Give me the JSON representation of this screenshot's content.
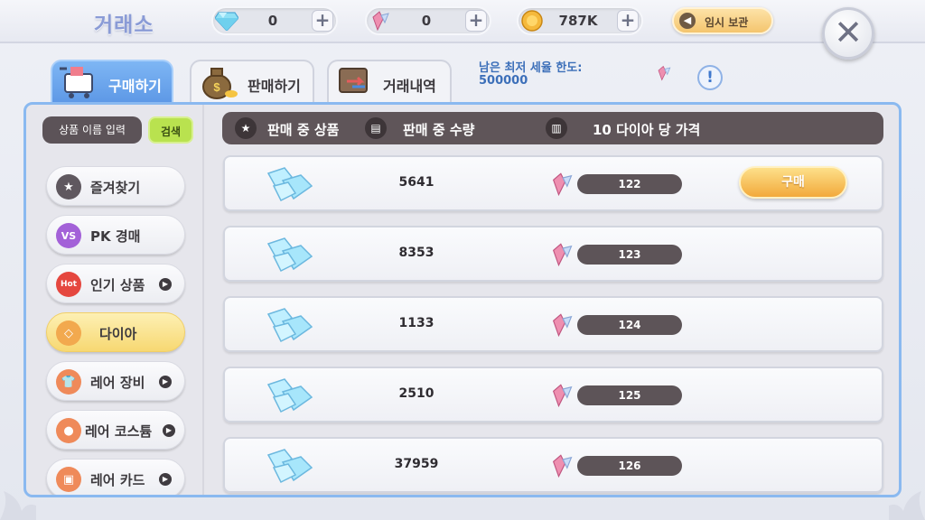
{
  "header": {
    "title": "거래소",
    "diamonds": "0",
    "gems": "0",
    "gold": "787K",
    "temp_storage": "임시 보관"
  },
  "tabs": [
    {
      "label": "구매하기",
      "active": true
    },
    {
      "label": "판매하기",
      "active": false
    },
    {
      "label": "거래내역",
      "active": false
    }
  ],
  "limit": {
    "label": "남은 최저 세율 한도:",
    "value": "500000"
  },
  "search": {
    "placeholder": "상품 이름 입력",
    "button": "검색"
  },
  "categories": [
    {
      "label": "즐겨찾기",
      "icon": "star-icon",
      "arrow": false
    },
    {
      "label": "PK 경매",
      "icon": "vs-icon",
      "arrow": false
    },
    {
      "label": "인기 상품",
      "icon": "hot-icon",
      "arrow": true
    },
    {
      "label": "다이아",
      "icon": "diamond-icon",
      "arrow": false,
      "active": true
    },
    {
      "label": "레어 장비",
      "icon": "shirt-icon",
      "arrow": true
    },
    {
      "label": "레어 코스튬",
      "icon": "costume-icon",
      "arrow": true
    },
    {
      "label": "레어 카드",
      "icon": "card-icon",
      "arrow": true
    }
  ],
  "table_header": {
    "item": "판매 중 상품",
    "quantity": "판매 중 수량",
    "price": "10 다이아 당 가격"
  },
  "listings": [
    {
      "quantity": "5641",
      "price": "122",
      "buy_label": "구매"
    },
    {
      "quantity": "8353",
      "price": "123"
    },
    {
      "quantity": "1133",
      "price": "124"
    },
    {
      "quantity": "2510",
      "price": "125"
    },
    {
      "quantity": "37959",
      "price": "126"
    }
  ],
  "colors": {
    "accent_blue": "#5d98e6",
    "buy_orange": "#f2a93b",
    "active_category": "#f7d872",
    "search_green": "#b9e24f"
  }
}
